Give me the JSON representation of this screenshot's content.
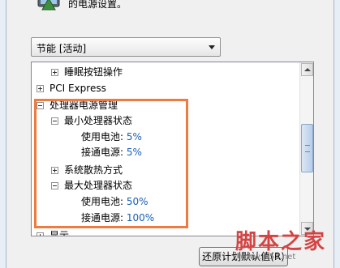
{
  "header": {
    "description": "的电源设置。"
  },
  "plan_select": {
    "value": "节能 [活动]"
  },
  "tree": {
    "sleep_buttons_label": "睡眠按钮操作",
    "pci_express_label": "PCI Express",
    "processor_power_label": "处理器电源管理",
    "min_state_label": "最小处理器状态",
    "min_battery_label": "使用电池:",
    "min_battery_value": "5%",
    "min_plugged_label": "接通电源:",
    "min_plugged_value": "5%",
    "cooling_policy_label": "系统散热方式",
    "max_state_label": "最大处理器状态",
    "max_battery_label": "使用电池:",
    "max_battery_value": "50%",
    "max_plugged_label": "接通电源:",
    "max_plugged_value": "100%",
    "display_label": "显示"
  },
  "buttons": {
    "restore_defaults": "还原计划默认值(R)"
  },
  "watermark": {
    "main": "脚本之家",
    "url": "www.jb51.net"
  },
  "colors": {
    "highlight": "#ee7b3f",
    "value_text": "#1a5fb4",
    "watermark": "#d44444"
  }
}
